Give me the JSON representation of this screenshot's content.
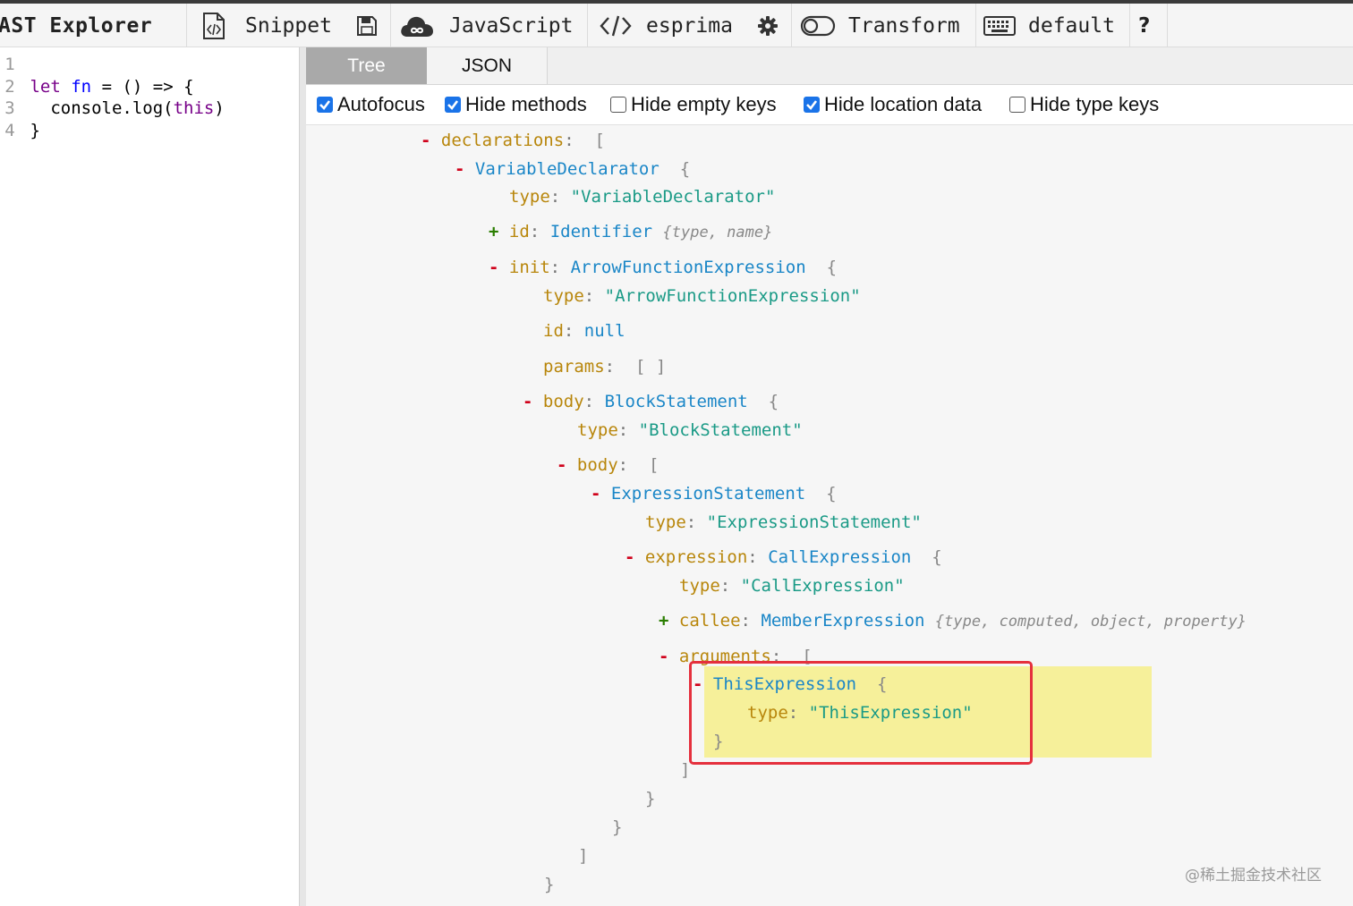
{
  "toolbar": {
    "title": "AST Explorer",
    "snippet_label": "Snippet",
    "language_label": "JavaScript",
    "parser_label": "esprima",
    "transform_label": "Transform",
    "keymap_label": "default",
    "help_label": "?"
  },
  "editor": {
    "lines": [
      {
        "num": "1",
        "parts": []
      },
      {
        "num": "2",
        "parts": [
          {
            "t": "let",
            "c": "kw"
          },
          {
            "t": " ",
            "c": "plain"
          },
          {
            "t": "fn",
            "c": "def"
          },
          {
            "t": " = () => {",
            "c": "plain"
          }
        ]
      },
      {
        "num": "3",
        "parts": [
          {
            "t": "  console.log(",
            "c": "plain"
          },
          {
            "t": "this",
            "c": "kw"
          },
          {
            "t": ")",
            "c": "plain"
          }
        ]
      },
      {
        "num": "4",
        "parts": [
          {
            "t": "}",
            "c": "plain"
          }
        ]
      }
    ]
  },
  "output": {
    "tabs": {
      "tree": "Tree",
      "json": "JSON"
    },
    "options": {
      "autofocus": {
        "label": "Autofocus",
        "checked": true
      },
      "hide_methods": {
        "label": "Hide methods",
        "checked": true
      },
      "hide_empty_keys": {
        "label": "Hide empty keys",
        "checked": false
      },
      "hide_location_data": {
        "label": "Hide location data",
        "checked": true
      },
      "hide_type_keys": {
        "label": "Hide type keys",
        "checked": false
      }
    }
  },
  "tree": [
    {
      "toggle": "-",
      "key": "declarations",
      "open": "["
    },
    {
      "toggle": "-",
      "type_name": "VariableDeclarator",
      "open": "{"
    },
    {
      "key": "type",
      "str": "\"VariableDeclarator\""
    },
    {
      "toggle": "+",
      "key": "id",
      "type_name": "Identifier",
      "summary": "{type, name}"
    },
    {
      "toggle": "-",
      "key": "init",
      "type_name": "ArrowFunctionExpression",
      "open": "{"
    },
    {
      "key": "type",
      "str": "\"ArrowFunctionExpression\""
    },
    {
      "key": "id",
      "literal": "null"
    },
    {
      "key": "params",
      "open": "[ ]"
    },
    {
      "toggle": "-",
      "key": "body",
      "type_name": "BlockStatement",
      "open": "{"
    },
    {
      "key": "type",
      "str": "\"BlockStatement\""
    },
    {
      "toggle": "-",
      "key": "body",
      "open": "["
    },
    {
      "toggle": "-",
      "type_name": "ExpressionStatement",
      "open": "{"
    },
    {
      "key": "type",
      "str": "\"ExpressionStatement\""
    },
    {
      "toggle": "-",
      "key": "expression",
      "type_name": "CallExpression",
      "open": "{"
    },
    {
      "key": "type",
      "str": "\"CallExpression\""
    },
    {
      "toggle": "+",
      "key": "callee",
      "type_name": "MemberExpression",
      "summary": "{type, computed, object, property}"
    },
    {
      "toggle": "-",
      "key": "arguments",
      "open": "["
    },
    {
      "toggle": "-",
      "type_name": "ThisExpression",
      "open": "{"
    },
    {
      "key": "type",
      "str": "\"ThisExpression\""
    },
    {
      "close": "}"
    },
    {
      "close": "]"
    },
    {
      "close": "}"
    },
    {
      "close": "}"
    },
    {
      "close": "]"
    },
    {
      "close": "}"
    }
  ],
  "watermark": "@稀土掘金技术社区",
  "colors": {
    "key": "#b8860b",
    "type_name": "#1a86c7",
    "string": "#1a9a86",
    "highlight": "#f6f09a",
    "callout": "#e5303d",
    "checkbox": "#1a73e8"
  }
}
